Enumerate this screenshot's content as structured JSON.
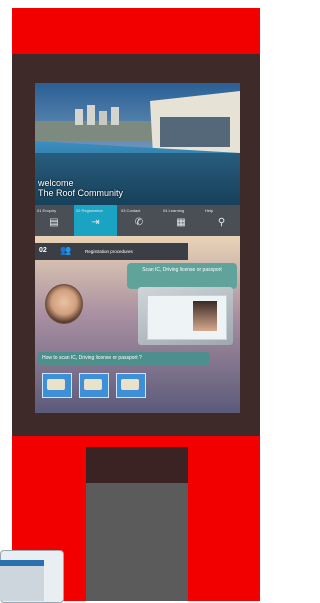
{
  "screen": {
    "welcome_line1": "welcome",
    "welcome_line2": "The Roof Community",
    "nav": [
      {
        "label": "01 Enquiry",
        "icon": "document-icon"
      },
      {
        "label": "02 Registration",
        "icon": "arrow-icon"
      },
      {
        "label": "03 Contact",
        "icon": "phone-icon"
      },
      {
        "label": "04 Learning",
        "icon": "grid-icon"
      },
      {
        "label": "Help",
        "icon": "search-icon"
      }
    ],
    "step": {
      "number": "02",
      "title": "Registration procedures"
    },
    "bubble_scan": "Scan IC, Driving license or passport",
    "bubble_howto": "How to scan IC, Driving license or passport ?"
  },
  "colors": {
    "kiosk_red": "#f20000",
    "frame": "#3f2a2a",
    "nav_active": "#1aa3c2"
  }
}
